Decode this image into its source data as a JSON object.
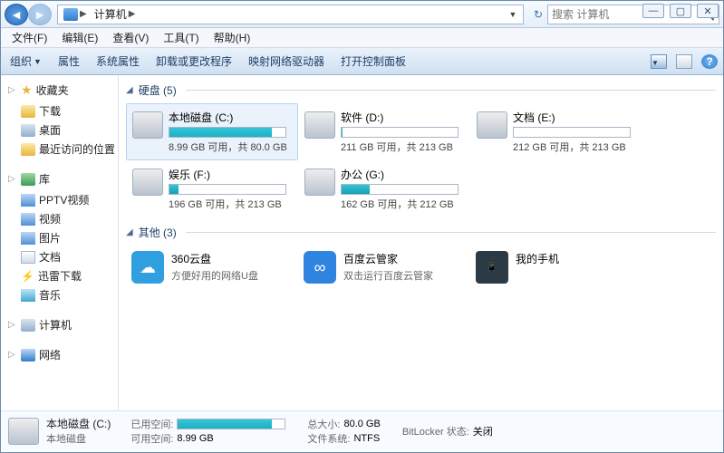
{
  "window_controls": {
    "min": "—",
    "max": "▢",
    "close": "✕"
  },
  "nav": {
    "back": "◄",
    "forward": "►"
  },
  "breadcrumb": {
    "root": "",
    "computer": "计算机",
    "refresh": "↻"
  },
  "search": {
    "placeholder": "搜索 计算机"
  },
  "menubar": [
    "文件(F)",
    "编辑(E)",
    "查看(V)",
    "工具(T)",
    "帮助(H)"
  ],
  "cmdbar": {
    "organize": "组织",
    "items": [
      "属性",
      "系统属性",
      "卸载或更改程序",
      "映射网络驱动器",
      "打开控制面板"
    ]
  },
  "navpane": {
    "favorites": {
      "label": "收藏夹",
      "items": [
        "下载",
        "桌面",
        "最近访问的位置"
      ]
    },
    "libraries": {
      "label": "库",
      "items": [
        "PPTV视频",
        "视频",
        "图片",
        "文档",
        "迅雷下载",
        "音乐"
      ]
    },
    "computer": {
      "label": "计算机"
    },
    "network": {
      "label": "网络"
    }
  },
  "content": {
    "hdd_label": "硬盘 (5)",
    "other_label": "其他 (3)",
    "drives": [
      {
        "name": "本地磁盘 (C:)",
        "freeText": "8.99 GB 可用，共 80.0 GB",
        "pct": 88,
        "color": "teal",
        "selected": true
      },
      {
        "name": "软件 (D:)",
        "freeText": "211 GB 可用，共 213 GB",
        "pct": 1,
        "color": "blue"
      },
      {
        "name": "文档 (E:)",
        "freeText": "212 GB 可用，共 213 GB",
        "pct": 0,
        "color": "blue"
      },
      {
        "name": "娱乐 (F:)",
        "freeText": "196 GB 可用，共 213 GB",
        "pct": 8,
        "color": "blue"
      },
      {
        "name": "办公 (G:)",
        "freeText": "162 GB 可用，共 212 GB",
        "pct": 24,
        "color": "blue"
      }
    ],
    "others": [
      {
        "name": "360云盘",
        "sub": "方便好用的网络U盘",
        "ico": "cloud360",
        "glyph": "☁"
      },
      {
        "name": "百度云管家",
        "sub": "双击运行百度云管家",
        "ico": "baidu",
        "glyph": "∞"
      },
      {
        "name": "我的手机",
        "sub": "",
        "ico": "phone",
        "glyph": "📱"
      }
    ]
  },
  "details": {
    "name": "本地磁盘 (C:)",
    "type": "本地磁盘",
    "used_k": "已用空间:",
    "used_pct": 88,
    "free_k": "可用空间:",
    "free_v": "8.99 GB",
    "total_k": "总大小:",
    "total_v": "80.0 GB",
    "fs_k": "文件系统:",
    "fs_v": "NTFS",
    "bitlocker_k": "BitLocker 状态:",
    "bitlocker_v": "关闭"
  }
}
